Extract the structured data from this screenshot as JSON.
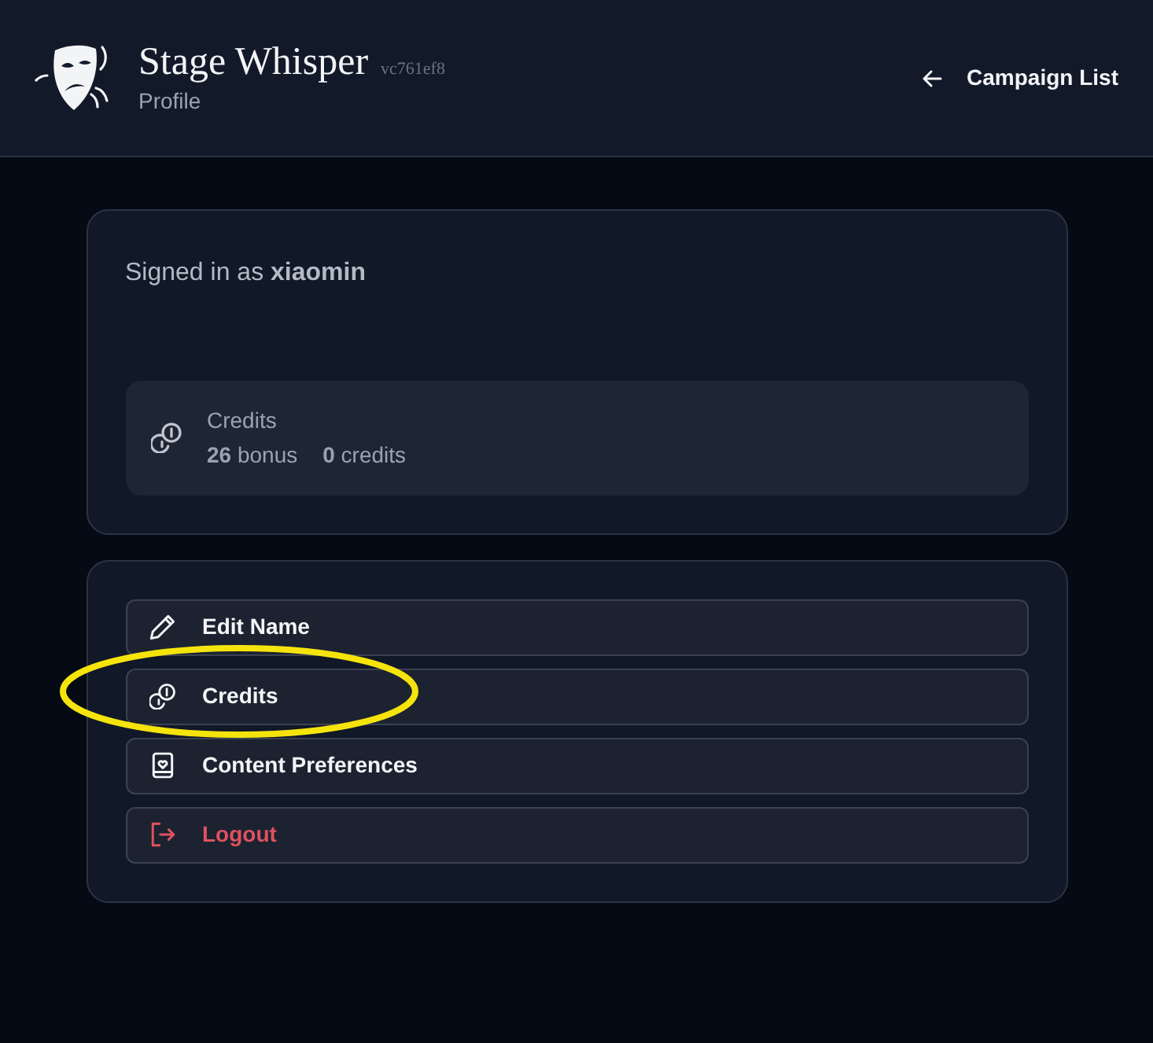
{
  "header": {
    "title": "Stage Whisper",
    "version": "vc761ef8",
    "subtitle": "Profile",
    "back_link": "Campaign List"
  },
  "account": {
    "signed_in": "Signed in as **xiaomin**"
  },
  "credits_summary": {
    "label": "Credits",
    "balances": [
      {
        "text": "**26** bonus"
      },
      {
        "text": "**0** credits"
      }
    ]
  },
  "menu": [
    {
      "label": "Edit Name",
      "kind": "edit",
      "highlighted": false
    },
    {
      "label": "Credits",
      "kind": "credits",
      "highlighted": true
    },
    {
      "label": "Content Preferences",
      "kind": "preferences",
      "highlighted": false
    },
    {
      "label": "Logout",
      "kind": "logout",
      "highlighted": false
    }
  ]
}
